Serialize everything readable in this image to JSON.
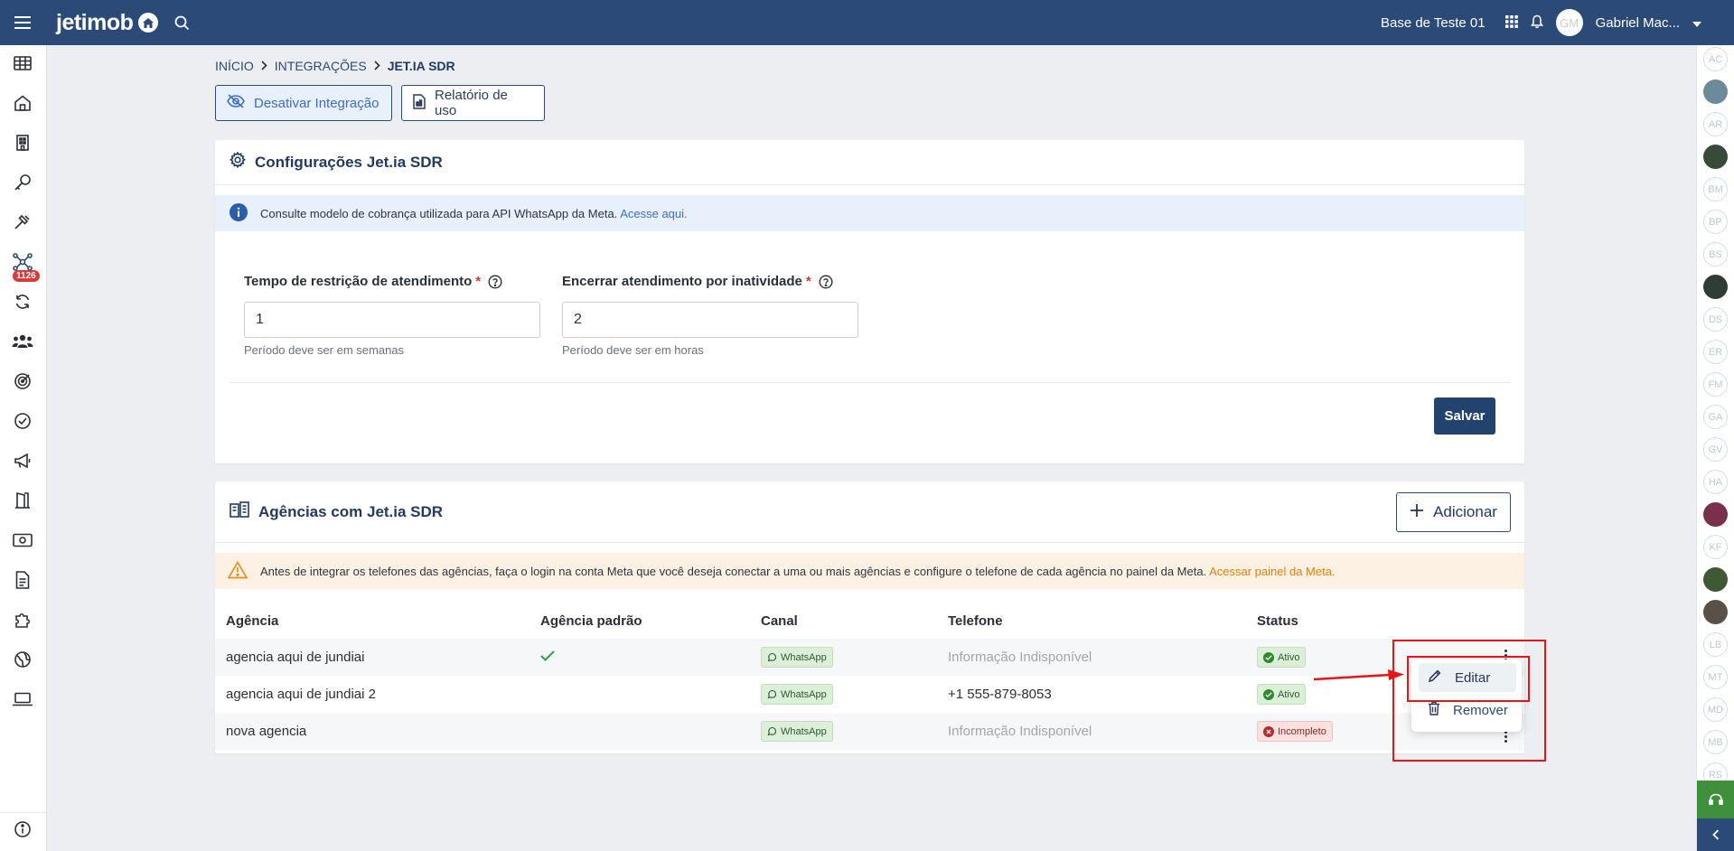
{
  "topbar": {
    "logo_text": "jetimob",
    "base_name": "Base de Teste 01",
    "avatar_initials": "GM",
    "user_name": "Gabriel Mac..."
  },
  "sidebar": {
    "items": [
      "grid-icon",
      "home-icon",
      "building-icon",
      "key-icon",
      "hammer-icon",
      "network-icon",
      "sync-icon",
      "team-icon",
      "target-icon",
      "check-circle-icon",
      "megaphone-icon",
      "door-icon",
      "money-icon",
      "document-icon",
      "puzzle-icon",
      "globe-icon",
      "laptop-icon",
      "info-icon"
    ],
    "badge": "1126"
  },
  "rightbar": {
    "avatars": [
      "AC",
      "",
      "AR",
      "",
      "BM",
      "BP",
      "BS",
      "",
      "DS",
      "ER",
      "FM",
      "GA",
      "GV",
      "HA",
      "",
      "KF",
      "",
      "",
      "LB",
      "MT",
      "MD",
      "MB",
      "RS"
    ]
  },
  "breadcrumb": {
    "home": "INÍCIO",
    "integrations": "INTEGRAÇÕES",
    "current": "JET.IA SDR"
  },
  "actions": {
    "deactivate": "Desativar Integração",
    "report": "Relatório de uso"
  },
  "config": {
    "title": "Configurações Jet.ia SDR",
    "info_text": "Consulte modelo de cobrança utilizada para API WhatsApp da Meta.",
    "info_link": "Acesse aqui.",
    "field1": {
      "label": "Tempo de restrição de atendimento",
      "required": "*",
      "value": "1",
      "hint": "Período deve ser em semanas"
    },
    "field2": {
      "label": "Encerrar atendimento por inatividade",
      "required": "*",
      "value": "2",
      "hint": "Período deve ser em horas"
    },
    "save": "Salvar"
  },
  "agencies": {
    "title": "Agências com Jet.ia SDR",
    "add": "Adicionar",
    "warn_text": "Antes de integrar os telefones das agências, faça o login na conta Meta que você deseja conectar a uma ou mais agências e configure o telefone de cada agência no painel da Meta.",
    "warn_link": "Acessar painel da Meta.",
    "columns": [
      "Agência",
      "Agência padrão",
      "Canal",
      "Telefone",
      "Status"
    ],
    "rows": [
      {
        "agency": "agencia aqui de jundiai",
        "default": true,
        "channel": "WhatsApp",
        "phone": "Informação Indisponível",
        "phone_available": false,
        "status": "Ativo"
      },
      {
        "agency": "agencia aqui de jundiai 2",
        "default": false,
        "channel": "WhatsApp",
        "phone": "+1 555-879-8053",
        "phone_available": true,
        "status": "Ativo"
      },
      {
        "agency": "nova agencia",
        "default": false,
        "channel": "WhatsApp",
        "phone": "Informação Indisponível",
        "phone_available": false,
        "status": "Incompleto"
      }
    ],
    "menu": {
      "edit": "Editar",
      "remove": "Remover"
    }
  },
  "colors": {
    "primary": "#2b4a78",
    "annotation": "#e8141a",
    "success": "#2f8a2b",
    "danger": "#d13a3a",
    "link_blue": "#3b6ec0",
    "link_orange": "#e07f12"
  }
}
